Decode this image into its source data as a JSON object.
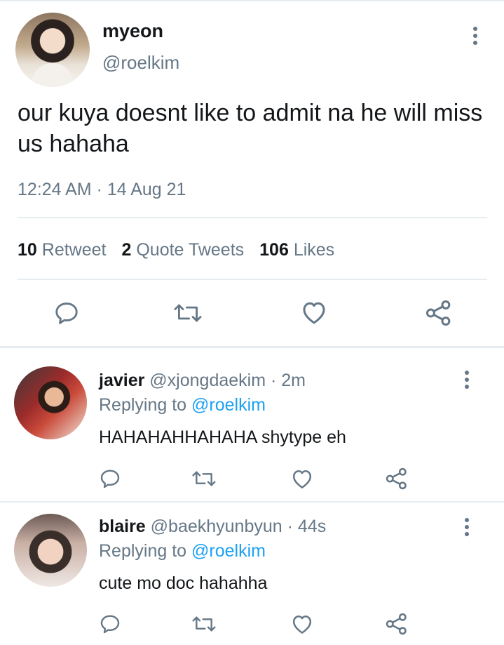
{
  "main_tweet": {
    "name": "myeon",
    "handle": "@roelkim",
    "text": "our kuya doesnt like to admit na he will miss us hahaha",
    "timestamp": "12:24 AM · 14 Aug 21",
    "stats": {
      "retweets_count": "10",
      "retweets_label": "Retweet",
      "quotes_count": "2",
      "quotes_label": "Quote Tweets",
      "likes_count": "106",
      "likes_label": "Likes"
    }
  },
  "replies": [
    {
      "name": "javier",
      "handle": "@xjongdaekim",
      "time": "· 2m",
      "replying_prefix": "Replying to",
      "replying_to": "@roelkim",
      "text": "HAHAHAHHAHAHA shytype eh"
    },
    {
      "name": "blaire",
      "handle": "@baekhyunbyun",
      "time": "· 44s",
      "replying_prefix": "Replying to",
      "replying_to": "@roelkim",
      "text": "cute mo doc hahahha"
    }
  ],
  "icons": [
    "reply-icon",
    "retweet-icon",
    "like-icon",
    "share-icon",
    "more-options-icon"
  ],
  "colors": {
    "text": "#14171a",
    "secondary": "#657786",
    "link": "#1da1f2",
    "divider": "#e6ecf0"
  }
}
